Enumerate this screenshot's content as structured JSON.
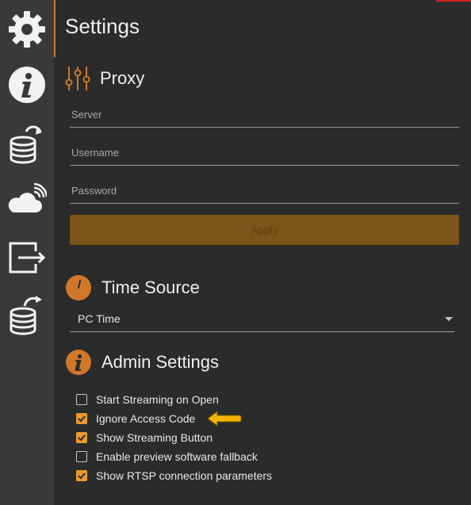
{
  "colors": {
    "accent": "#d0782a",
    "check": "#e89a2e",
    "arrow": "#f5b400",
    "sidebar": "#393939",
    "background": "#2b2b2b"
  },
  "sidebar": {
    "items": [
      {
        "icon": "gear-icon"
      },
      {
        "icon": "info-icon"
      },
      {
        "icon": "database-import-icon"
      },
      {
        "icon": "cloud-signal-icon"
      },
      {
        "icon": "export-icon"
      },
      {
        "icon": "database-export-icon"
      }
    ]
  },
  "page": {
    "title": "Settings"
  },
  "proxy": {
    "title": "Proxy",
    "icon": "sliders-icon",
    "server_placeholder": "Server",
    "username_placeholder": "Username",
    "password_placeholder": "Password",
    "apply_label": "Apply"
  },
  "time_source": {
    "title": "Time Source",
    "icon": "clock-icon",
    "selected": "PC Time"
  },
  "admin": {
    "title": "Admin Settings",
    "icon": "info-icon",
    "options": [
      {
        "label": "Start Streaming on Open",
        "checked": false
      },
      {
        "label": "Ignore Access Code",
        "checked": true
      },
      {
        "label": "Show Streaming Button",
        "checked": true
      },
      {
        "label": "Enable preview software fallback",
        "checked": false
      },
      {
        "label": "Show RTSP connection parameters",
        "checked": true
      }
    ]
  }
}
